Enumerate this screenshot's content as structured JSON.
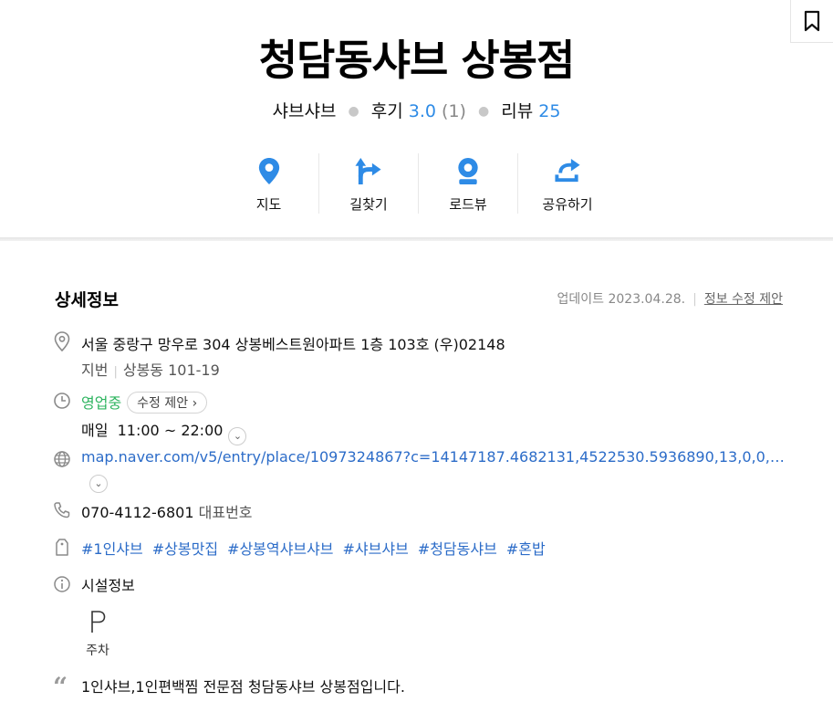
{
  "header": {
    "title": "청담동샤브 상봉점",
    "category": "샤브샤브",
    "review_label": "후기",
    "review_score": "3.0",
    "review_count": "(1)",
    "blog_label": "리뷰",
    "blog_count": "25"
  },
  "actions": [
    {
      "label": "지도",
      "icon": "map-pin-icon"
    },
    {
      "label": "길찾기",
      "icon": "directions-icon"
    },
    {
      "label": "로드뷰",
      "icon": "roadview-icon"
    },
    {
      "label": "공유하기",
      "icon": "share-icon"
    }
  ],
  "details": {
    "title": "상세정보",
    "updated": "업데이트 2023.04.28.",
    "suggest": "정보 수정 제안",
    "address": "서울 중랑구 망우로 304 상봉베스트원아파트 1층 103호 (우)02148",
    "jibun_label": "지번",
    "jibun": "상봉동 101-19",
    "status": "영업중",
    "status_chip": "수정 제안",
    "hours_day": "매일",
    "hours": "11:00 ~ 22:00",
    "url": "map.naver.com/v5/entry/place/1097324867?c=14147187.4682131,4522530.5936890,13,0,0,…",
    "phone": "070-4112-6801",
    "phone_label": "대표번호",
    "tags": [
      "#1인샤브",
      "#상봉맛집",
      "#상봉역샤브샤브",
      "#샤브샤브",
      "#청담동샤브",
      "#혼밥"
    ],
    "facility_label": "시설정보",
    "parking": "주차",
    "description": "1인샤브,1인편백찜 전문점 청담동샤브 상봉점입니다."
  },
  "colors": {
    "accent": "#2e8be6",
    "open": "#2db45f",
    "link": "#2c6cc8"
  }
}
